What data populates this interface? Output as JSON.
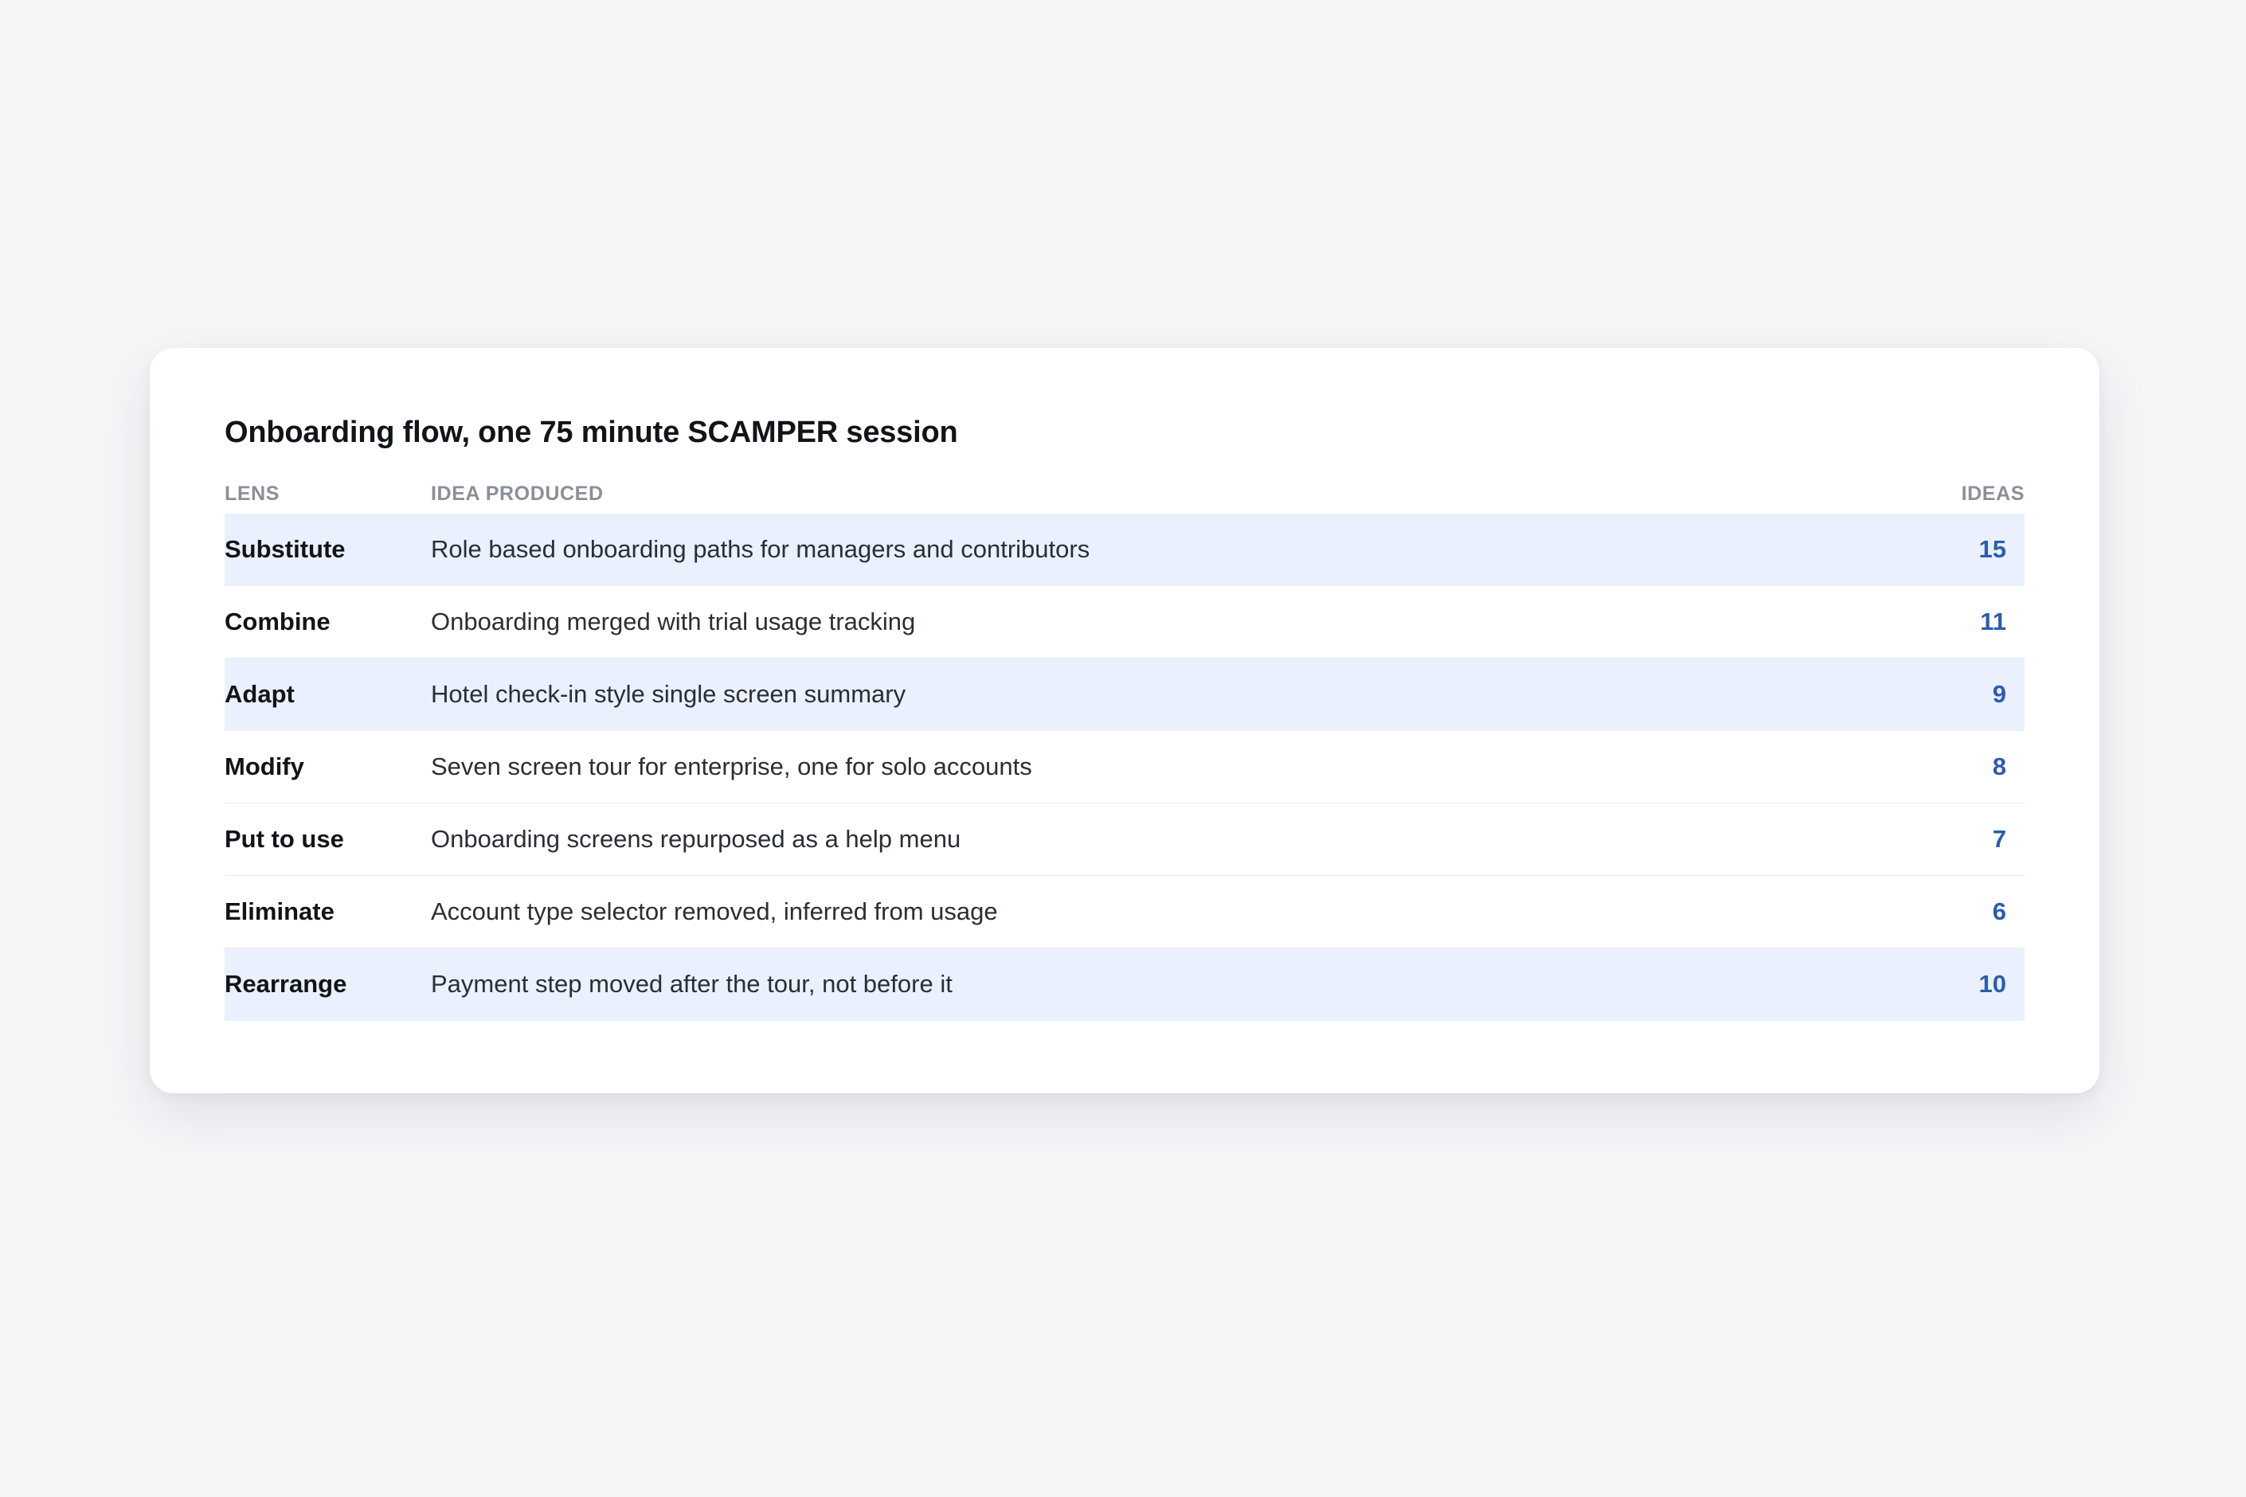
{
  "card": {
    "title": "Onboarding flow, one 75 minute SCAMPER session"
  },
  "table": {
    "headers": {
      "lens": "LENS",
      "idea": "IDEA PRODUCED",
      "ideas": "IDEAS"
    },
    "rows": [
      {
        "lens": "Substitute",
        "idea": "Role based onboarding paths for managers and contributors",
        "ideas": "15",
        "highlighted": true
      },
      {
        "lens": "Combine",
        "idea": "Onboarding merged with trial usage tracking",
        "ideas": "11",
        "highlighted": false
      },
      {
        "lens": "Adapt",
        "idea": "Hotel check-in style single screen summary",
        "ideas": "9",
        "highlighted": true
      },
      {
        "lens": "Modify",
        "idea": "Seven screen tour for enterprise, one for solo accounts",
        "ideas": "8",
        "highlighted": false
      },
      {
        "lens": "Put to use",
        "idea": "Onboarding screens repurposed as a help menu",
        "ideas": "7",
        "highlighted": false
      },
      {
        "lens": "Eliminate",
        "idea": "Account type selector removed, inferred from usage",
        "ideas": "6",
        "highlighted": false
      },
      {
        "lens": "Rearrange",
        "idea": "Payment step moved after the tour, not before it",
        "ideas": "10",
        "highlighted": true
      }
    ]
  },
  "colors": {
    "page_background": "#f5f6f8",
    "card_background": "#ffffff",
    "highlight_row": "#eaf0fd",
    "count_accent": "#2a5db0",
    "header_text": "#8a8f98"
  }
}
